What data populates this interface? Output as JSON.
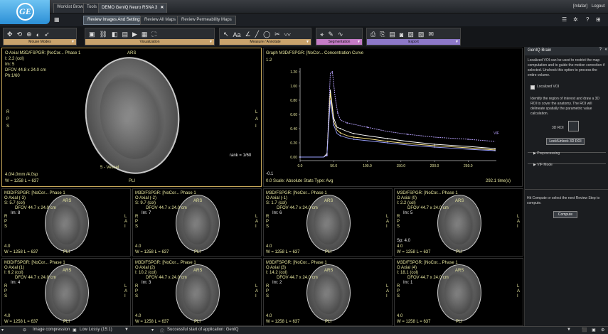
{
  "titlebar": {
    "tabs": [
      {
        "label": "Worklist Browser"
      },
      {
        "label": "Tools"
      },
      {
        "label": "DEMO GenIQ Neuro RSNA 3",
        "close": "✕"
      }
    ],
    "user": "[mlafar]",
    "logout": "Logout"
  },
  "review_tabs": [
    {
      "label": "Review Images And Settings"
    },
    {
      "label": "Review All Maps"
    },
    {
      "label": "Review Permeability Maps"
    }
  ],
  "toolbar": {
    "groups": [
      {
        "label": "Mouse Modes"
      },
      {
        "label": "Visualization"
      },
      {
        "label": "Measure / Annotate"
      },
      {
        "label": "Segmentation"
      },
      {
        "label": "Export"
      }
    ]
  },
  "main_viewer": {
    "title": "O Axial M3D/FSPGR: [NoCor... Phase 1",
    "ars": "ARS",
    "l": "I: 2.2 (col)",
    "im": "Im: 5",
    "dfov": "DFOV 44.8 x 24.0 cm",
    "ph": "Ph:1/60",
    "r": "R",
    "p": "P",
    "s": "S",
    "L": "L",
    "A": "A",
    "I": "I",
    "thickness": "4.0/4.0mm /4.0sp",
    "wl": "W = 1258 L = 637",
    "pli": "PLI",
    "rank": "rank = 1/60",
    "vessel": "5 - Vessel"
  },
  "graph": {
    "title": "Graph M3D/FSPGR: [NoCor... Concentration Curve",
    "ymax": "1.2",
    "status": "0.0 Scale: Absolute Stats Type: Avg",
    "time": "292.1 time(s)",
    "ymin": "-0.1",
    "vif_label": "VIF",
    "y_ticks": [
      "1.20",
      "1.00",
      "0.80",
      "0.60",
      "0.40",
      "0.20",
      "0.00"
    ],
    "x_ticks": [
      "0.0",
      "50.0",
      "100.0",
      "150.0",
      "200.0",
      "250.0"
    ]
  },
  "chart_data": {
    "type": "line",
    "title": "Concentration Curve",
    "xlabel": "time(s)",
    "ylabel": "",
    "ylim": [
      -0.05,
      1.25
    ],
    "xlim": [
      0,
      292
    ],
    "series": [
      {
        "name": "VIF",
        "color": "#b8a2ff",
        "x": [
          0,
          35,
          40,
          45,
          48,
          52,
          56,
          60,
          70,
          80,
          100,
          130,
          160,
          200,
          250,
          290
        ],
        "y": [
          0.0,
          0.0,
          0.02,
          1.18,
          1.2,
          0.85,
          0.62,
          0.52,
          0.48,
          0.46,
          0.42,
          0.36,
          0.32,
          0.28,
          0.25,
          0.22
        ]
      },
      {
        "name": "",
        "color": "#ffffff",
        "x": [
          0,
          35,
          40,
          45,
          50,
          55,
          60,
          70,
          80,
          100,
          130,
          160,
          200,
          250,
          290
        ],
        "y": [
          0.0,
          0.0,
          0.05,
          0.95,
          0.55,
          0.42,
          0.4,
          0.36,
          0.33,
          0.3,
          0.26,
          0.22,
          0.18,
          0.15,
          0.12
        ]
      },
      {
        "name": "",
        "color": "#ffe98a",
        "x": [
          0,
          35,
          40,
          45,
          50,
          55,
          60,
          70,
          80,
          100,
          130,
          160,
          200,
          250,
          290
        ],
        "y": [
          0.0,
          0.0,
          0.04,
          0.9,
          0.5,
          0.38,
          0.34,
          0.3,
          0.28,
          0.26,
          0.22,
          0.19,
          0.16,
          0.13,
          0.1
        ]
      },
      {
        "name": "",
        "color": "#9aa0ff",
        "x": [
          0,
          35,
          40,
          45,
          50,
          55,
          60,
          70,
          80,
          100,
          130,
          160,
          200,
          250,
          290
        ],
        "y": [
          0.0,
          0.0,
          0.03,
          0.8,
          0.45,
          0.33,
          0.3,
          0.27,
          0.25,
          0.23,
          0.2,
          0.17,
          0.14,
          0.11,
          0.09
        ]
      }
    ]
  },
  "thumbs": [
    {
      "title": "M3D/FSPGR: [NoCor... Phase 1",
      "axial": "O Axial (-3)",
      "loc": "S: 5.7 (col)",
      "dfov": "DFOV 44.7 x 24.0 cm",
      "im": "Im: 8",
      "thick": "4.0",
      "wl": "W = 1258 L = 637",
      "extra": ""
    },
    {
      "title": "M3D/FSPGR: [NoCor... Phase 1",
      "axial": "O Axial (-2)",
      "loc": "S: 9.7 (col)",
      "dfov": "DFOV 44.7 x 24.0 cm",
      "im": "Im: 7",
      "thick": "4.0",
      "wl": "W = 1258 L = 637",
      "extra": ""
    },
    {
      "title": "M3D/FSPGR: [NoCor... Phase 1",
      "axial": "O Axial (-1)",
      "loc": "S: 1.7 (col)",
      "dfov": "DFOV 44.7 x 24.0 cm",
      "im": "Im: 6",
      "thick": "4.0",
      "wl": "W = 1258 L = 637",
      "extra": ""
    },
    {
      "title": "M3D/FSPGR: [NoCor... Phase 1",
      "axial": "O Axial (0)",
      "loc": "I: 2.2 (col)",
      "dfov": "DFOV 44.7 x 24.0 cm",
      "im": "Im: 5",
      "thick": "4.0",
      "wl": "W = 1258 L = 637",
      "extra": "Sp: 4.0"
    },
    {
      "title": "M3D/FSPGR: [NoCor... Phase 1",
      "axial": "O Axial (1)",
      "loc": "I: 6.2 (col)",
      "dfov": "DFOV 44.7 x 24.0 cm",
      "im": "Im: 4",
      "thick": "4.0",
      "wl": "W = 1258 L = 637",
      "extra": ""
    },
    {
      "title": "M3D/FSPGR: [NoCor... Phase 1",
      "axial": "O Axial (2)",
      "loc": "I: 10.2 (col)",
      "dfov": "DFOV 44.7 x 24.0 cm",
      "im": "Im: 3",
      "thick": "4.0",
      "wl": "W = 1258 L = 637",
      "extra": ""
    },
    {
      "title": "M3D/FSPGR: [NoCor... Phase 1",
      "axial": "O Axial (3)",
      "loc": "I: 14.2 (col)",
      "dfov": "DFOV 44.7 x 24.0 cm",
      "im": "Im: 2",
      "thick": "4.0",
      "wl": "W = 1258 L = 637",
      "extra": ""
    },
    {
      "title": "M3D/FSPGR: [NoCor... Phase 1",
      "axial": "O Axial (4)",
      "loc": "I: 18.1 (col)",
      "dfov": "DFOV 44.7 x 24.0 cm",
      "im": "Im: 1",
      "thick": "4.0",
      "wl": "W = 1258 L = 637",
      "extra": ""
    }
  ],
  "thumb_common": {
    "ars": "ARS",
    "pli": "PLI",
    "r": "R",
    "p": "P",
    "s": "S",
    "l": "L",
    "a": "A",
    "i": "I"
  },
  "side_panel": {
    "title": "GenIQ Brain",
    "intro": "Localized VOI can be used to restrict the map computation and to guide the motion correction if selected. Uncheck this option to process the entire volume.",
    "checkbox_label": "Localized VOI",
    "instructions": "Identify the region of interest and draw a 3D ROI to cover the anatomy. The ROI will delineate spatially the parametric value calculation.",
    "roi_label": "3D ROI",
    "lock_button": "Lock/Unlock 3D ROI",
    "preprocessing": "Preprocessing",
    "vif_mode": "VIF Mode",
    "hint": "Hit Compute or select the next Review Step to compute.",
    "compute_button": "Compute"
  },
  "statusbar": {
    "compression_label": "Image compression",
    "compression_value": "Low Lossy (15:1)",
    "message": "Successful start of application: GenIQ"
  }
}
